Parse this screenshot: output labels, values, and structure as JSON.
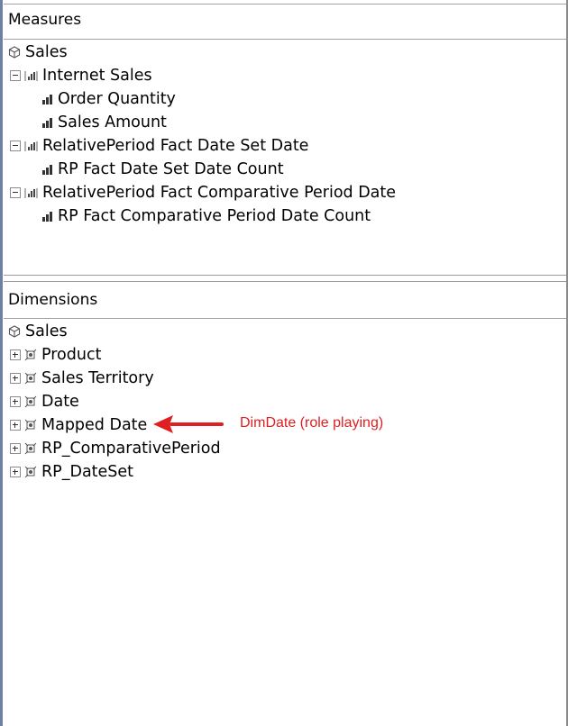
{
  "measures": {
    "title": "Measures",
    "cube": "Sales",
    "groups": [
      {
        "label": "Internet Sales",
        "items": [
          "Order Quantity",
          "Sales Amount"
        ]
      },
      {
        "label": "RelativePeriod Fact Date Set Date",
        "items": [
          "RP Fact Date Set Date Count"
        ]
      },
      {
        "label": "RelativePeriod Fact Comparative Period Date",
        "items": [
          "RP Fact Comparative Period Date Count"
        ]
      }
    ]
  },
  "dimensions": {
    "title": "Dimensions",
    "cube": "Sales",
    "items": [
      "Product",
      "Sales Territory",
      "Date",
      "Mapped Date",
      "RP_ComparativePeriod",
      "RP_DateSet"
    ]
  },
  "annotation": {
    "text": "DimDate (role playing)",
    "color": "#e02020"
  }
}
